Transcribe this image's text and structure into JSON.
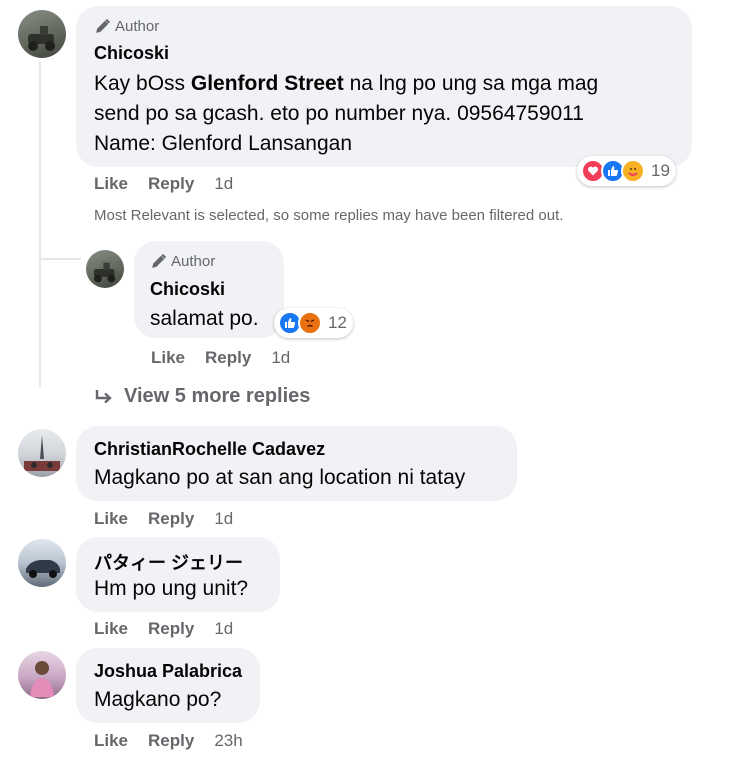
{
  "comments": [
    {
      "author_badge": "Author",
      "name": "Chicoski",
      "text_line1_pre": "Kay bOss ",
      "text_line1_bold": "Glenford Street",
      "text_line1_post": " na lng po ung sa mga mag",
      "text_line2": "send po sa gcash. eto po number nya. 09564759011",
      "text_line3": "Name: Glenford Lansangan",
      "reaction_count": "19",
      "like": "Like",
      "reply": "Reply",
      "time": "1d"
    },
    {
      "author_badge": "Author",
      "name": "Chicoski",
      "text": "salamat po.",
      "reaction_count": "12",
      "like": "Like",
      "reply": "Reply",
      "time": "1d"
    },
    {
      "name": "ChristianRochelle Cadavez",
      "text": "Magkano po at san ang location ni tatay",
      "like": "Like",
      "reply": "Reply",
      "time": "1d"
    },
    {
      "name": "パタィー ジェリー",
      "text": "Hm po ung unit?",
      "like": "Like",
      "reply": "Reply",
      "time": "1d"
    },
    {
      "name": "Joshua Palabrica",
      "text": "Magkano po?",
      "like": "Like",
      "reply": "Reply",
      "time": "23h"
    }
  ],
  "filter_note": "Most Relevant is selected, so some replies may have been filtered out.",
  "view_more": "View 5 more replies",
  "colors": {
    "bubble": "#f0f2f5",
    "meta_text": "#65676b",
    "like_blue": "#1877f2",
    "love_red": "#f33e58",
    "care_yellow": "#f7b125"
  }
}
